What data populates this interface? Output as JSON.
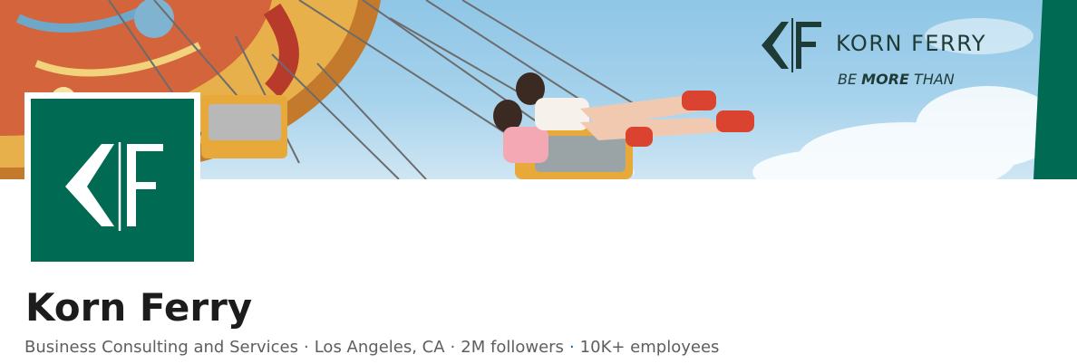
{
  "cover": {
    "brand_name": "KORN FERRY",
    "tagline_be": "BE ",
    "tagline_more": "MORE",
    "tagline_than": " THAN"
  },
  "company": {
    "name": "Korn Ferry",
    "industry": "Business Consulting and Services",
    "location": "Los Angeles, CA",
    "followers": "2M followers",
    "employees": "10K+ employees",
    "separator": "·"
  },
  "colors": {
    "brand_green": "#006a52",
    "text_dark": "#1c1c1c",
    "text_muted": "#5e5e5e",
    "link_blue": "#0a66c2"
  },
  "icons": {
    "logo": "korn-ferry-kf-monogram",
    "cover_logo": "korn-ferry-kf-monogram"
  }
}
